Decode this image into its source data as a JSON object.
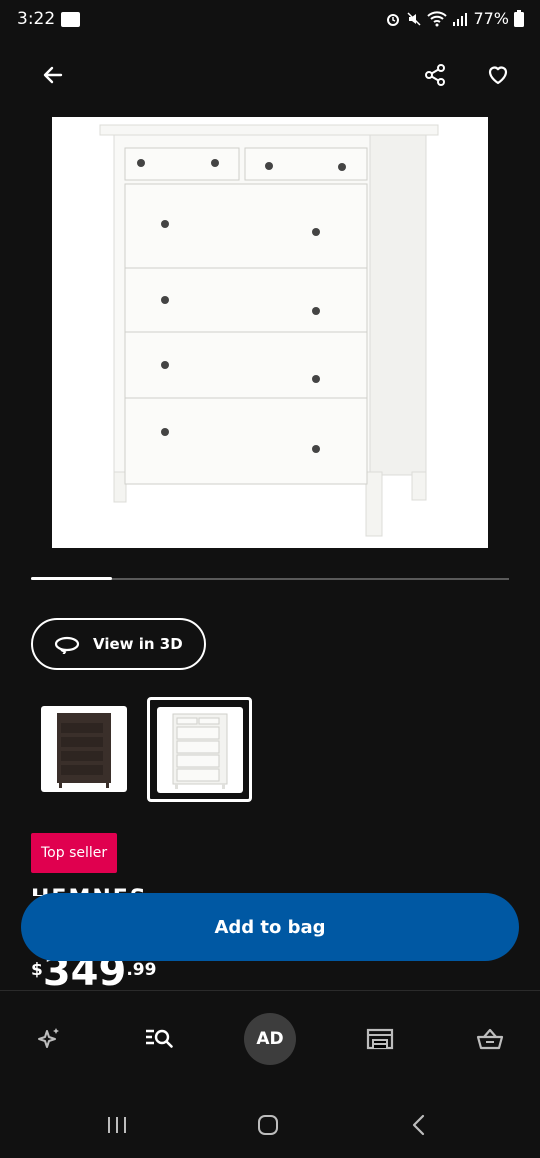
{
  "status": {
    "time": "3:22",
    "battery": "77%",
    "icons": [
      "voicemail-icon",
      "alarm-icon",
      "mute-icon",
      "wifi-icon",
      "signal-icon",
      "battery-icon"
    ]
  },
  "header": {
    "back_icon": "arrow-left-icon",
    "share_icon": "share-icon",
    "favorite_icon": "heart-icon"
  },
  "gallery": {
    "image_alt": "white chest of 6 drawers",
    "progress": 0.17
  },
  "view3d": {
    "label": "View in 3D"
  },
  "swatches": [
    {
      "name": "black-brown",
      "color": "#3a2f2a",
      "selected": false
    },
    {
      "name": "white stain",
      "color": "#f2f2f0",
      "selected": true
    }
  ],
  "product": {
    "badge": "Top seller",
    "name": "HEMNES",
    "price": {
      "currency": "$",
      "integer": "349",
      "decimal": ".99"
    }
  },
  "actions": {
    "add_to_bag": "Add to bag"
  },
  "nav": {
    "items": [
      "sparkle-icon",
      "search-list-icon",
      "profile",
      "store-icon",
      "basket-icon"
    ],
    "profile_initials": "AD"
  },
  "colors": {
    "background": "#111111",
    "primary": "#0058a3",
    "badge": "#e0004f"
  }
}
